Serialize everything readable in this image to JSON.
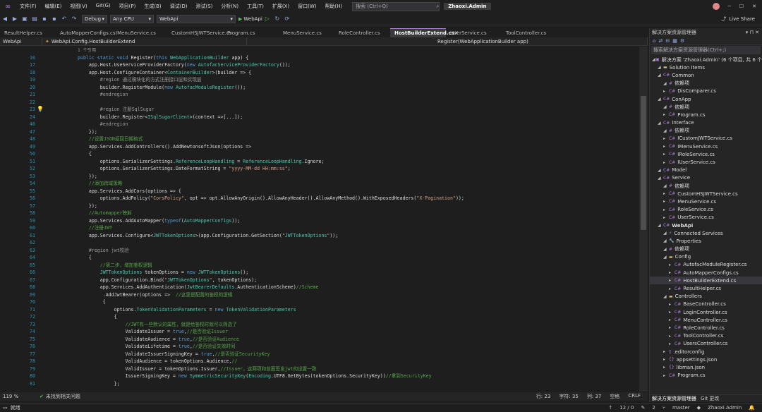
{
  "menu": {
    "items": [
      "文件(F)",
      "编辑(E)",
      "视图(V)",
      "Git(G)",
      "项目(P)",
      "生成(B)",
      "调试(D)",
      "测试(S)",
      "分析(N)",
      "工具(T)",
      "扩展(X)",
      "窗口(W)",
      "帮助(H)"
    ],
    "search_placeholder": "搜索 (Ctrl+Q)",
    "solution_name": "Zhaoxi.Admin"
  },
  "toolbar": {
    "config": "Debug",
    "platform": "Any CPU",
    "startup": "WebApi",
    "run_label": "WebApi",
    "live_share": "Live Share"
  },
  "tabs": [
    {
      "label": "ResultHelper.cs",
      "active": false
    },
    {
      "label": "AutoMapperConfigs.cs",
      "active": false
    },
    {
      "label": "IMenuService.cs",
      "active": false
    },
    {
      "label": "CustomHSJWTService.cs",
      "active": false
    },
    {
      "label": "Program.cs",
      "active": false
    },
    {
      "label": "MenuService.cs",
      "active": false
    },
    {
      "label": "RoleController.cs",
      "active": false
    },
    {
      "label": "HostBuilderExtend.cs",
      "active": true
    },
    {
      "label": "UserService.cs",
      "active": false
    },
    {
      "label": "ToolController.cs",
      "active": false
    }
  ],
  "nav": {
    "project": "WebApi",
    "class": "WebApi.Config.HostBuilderExtend",
    "member": "Register(WebApplicationBuilder app)"
  },
  "code": {
    "ref_hint": "1 个引用",
    "lines": [
      {
        "n": "16",
        "t": "public static void Register(this WebApplicationBuilder app) {"
      },
      {
        "n": "17",
        "t": "    app.Host.UseServiceProviderFactory(new AutofacServiceProviderFactory());"
      },
      {
        "n": "18",
        "t": "    app.Host.ConfigureContainer<ContainerBuilder>(builder => {"
      },
      {
        "n": "19",
        "t": "        #region 通过模块化的方式注册接口层和实现层"
      },
      {
        "n": "20",
        "t": "        builder.RegisterModule(new AutofacModuleRegister());"
      },
      {
        "n": "21",
        "t": "        #endregion"
      },
      {
        "n": "22",
        "t": ""
      },
      {
        "n": "23",
        "t": "        #region 注册SqlSugar"
      },
      {
        "n": "24",
        "t": "        builder.Register<ISqlSugarClient>(context =>[...]);"
      },
      {
        "n": "46",
        "t": "        #endregion"
      },
      {
        "n": "47",
        "t": "    });"
      },
      {
        "n": "48",
        "t": "    //设置JSON返回日期格式"
      },
      {
        "n": "49",
        "t": "    app.Services.AddControllers().AddNewtonsoftJson(options =>"
      },
      {
        "n": "50",
        "t": "    {"
      },
      {
        "n": "51",
        "t": "        options.SerializerSettings.ReferenceLoopHandling = ReferenceLoopHandling.Ignore;"
      },
      {
        "n": "52",
        "t": "        options.SerializerSettings.DateFormatString = \"yyyy-MM-dd HH:mm:ss\";"
      },
      {
        "n": "53",
        "t": "    });"
      },
      {
        "n": "54",
        "t": "    //添加跨域策略"
      },
      {
        "n": "55",
        "t": "    app.Services.AddCors(options => {"
      },
      {
        "n": "56",
        "t": "        options.AddPolicy(\"CorsPolicy\", opt => opt.AllowAnyOrigin().AllowAnyHeader().AllowAnyMethod().WithExposedHeaders(\"X-Pagination\"));"
      },
      {
        "n": "57",
        "t": "    });"
      },
      {
        "n": "58",
        "t": "    //Automapper映射"
      },
      {
        "n": "59",
        "t": "    app.Services.AddAutoMapper(typeof(AutoMapperConfigs));"
      },
      {
        "n": "60",
        "t": "    //注册JWT"
      },
      {
        "n": "61",
        "t": "    app.Services.Configure<JWTTokenOptions>(app.Configuration.GetSection(\"JWTTokenOptions\"));"
      },
      {
        "n": "62",
        "t": ""
      },
      {
        "n": "63",
        "t": "    #region jwt校验"
      },
      {
        "n": "64",
        "t": "    {"
      },
      {
        "n": "65",
        "t": "        //第二步，增加鉴权逻辑"
      },
      {
        "n": "66",
        "t": "        JWTTokenOptions tokenOptions = new JWTTokenOptions();"
      },
      {
        "n": "67",
        "t": "        app.Configuration.Bind(\"JWTTokenOptions\", tokenOptions);"
      },
      {
        "n": "68",
        "t": "        app.Services.AddAuthentication(JwtBearerDefaults.AuthenticationScheme)//Scheme"
      },
      {
        "n": "69",
        "t": "         .AddJwtBearer(options =>  //这里是配置的鉴权的逻辑"
      },
      {
        "n": "70",
        "t": "         {"
      },
      {
        "n": "71",
        "t": "             options.TokenValidationParameters = new TokenValidationParameters"
      },
      {
        "n": "72",
        "t": "             {"
      },
      {
        "n": "73",
        "t": "                 //JWT有一些默认的属性，就是给鉴权时就可以筛选了"
      },
      {
        "n": "74",
        "t": "                 ValidateIssuer = true,//是否验证Issuer"
      },
      {
        "n": "75",
        "t": "                 ValidateAudience = true,//是否验证Audience"
      },
      {
        "n": "76",
        "t": "                 ValidateLifetime = true,//是否验证失效时间"
      },
      {
        "n": "77",
        "t": "                 ValidateIssuerSigningKey = true,//是否验证SecurityKey"
      },
      {
        "n": "78",
        "t": "                 ValidAudience = tokenOptions.Audience,//"
      },
      {
        "n": "79",
        "t": "                 ValidIssuer = tokenOptions.Issuer,//Issuer，这两项和前面签发jwt的设置一致"
      },
      {
        "n": "80",
        "t": "                 IssuerSigningKey = new SymmetricSecurityKey(Encoding.UTF8.GetBytes(tokenOptions.SecurityKey))//拿到SecurityKey"
      },
      {
        "n": "81",
        "t": "             };"
      }
    ]
  },
  "editor_status": {
    "zoom": "119 %",
    "issues": "未找到相关问题",
    "line": "行: 23",
    "col": "字符: 35",
    "pos": "列: 37",
    "space": "空格",
    "crlf": "CRLF"
  },
  "statusbar": {
    "ready": "就绪",
    "lines": "12 / 0",
    "pencil": "2",
    "branch": "master",
    "repo": "Zhaoxi.Admin"
  },
  "solution_explorer": {
    "title": "解决方案资源管理器",
    "search_placeholder": "搜索解决方案资源管理器(Ctrl+;)",
    "rows": [
      {
        "label": "解决方案 'Zhaoxi.Admin' (6 个项目, 共 6 个",
        "indent": 0,
        "icon": "sln",
        "sel": false
      },
      {
        "label": "Solution Items",
        "indent": 1,
        "icon": "folder",
        "sel": false
      },
      {
        "label": "Common",
        "indent": 1,
        "icon": "proj",
        "sel": false
      },
      {
        "label": "依赖项",
        "indent": 2,
        "icon": "dep",
        "sel": false
      },
      {
        "label": "DisComparer.cs",
        "indent": 2,
        "icon": "cs",
        "sel": false
      },
      {
        "label": "ConApp",
        "indent": 1,
        "icon": "proj",
        "sel": false
      },
      {
        "label": "依赖项",
        "indent": 2,
        "icon": "dep",
        "sel": false
      },
      {
        "label": "Program.cs",
        "indent": 2,
        "icon": "cs",
        "sel": false
      },
      {
        "label": "Interface",
        "indent": 1,
        "icon": "proj",
        "sel": false
      },
      {
        "label": "依赖项",
        "indent": 2,
        "icon": "dep",
        "sel": false
      },
      {
        "label": "ICustomJWTService.cs",
        "indent": 2,
        "icon": "cs",
        "sel": false
      },
      {
        "label": "IMenuService.cs",
        "indent": 2,
        "icon": "cs",
        "sel": false
      },
      {
        "label": "IRoleService.cs",
        "indent": 2,
        "icon": "cs",
        "sel": false
      },
      {
        "label": "IUserService.cs",
        "indent": 2,
        "icon": "cs",
        "sel": false
      },
      {
        "label": "Model",
        "indent": 1,
        "icon": "proj",
        "sel": false
      },
      {
        "label": "Service",
        "indent": 1,
        "icon": "proj",
        "sel": false
      },
      {
        "label": "依赖项",
        "indent": 2,
        "icon": "dep",
        "sel": false
      },
      {
        "label": "CustomHSJWTService.cs",
        "indent": 2,
        "icon": "cs",
        "sel": false
      },
      {
        "label": "MenuService.cs",
        "indent": 2,
        "icon": "cs",
        "sel": false
      },
      {
        "label": "RoleService.cs",
        "indent": 2,
        "icon": "cs",
        "sel": false
      },
      {
        "label": "UserService.cs",
        "indent": 2,
        "icon": "cs",
        "sel": false
      },
      {
        "label": "WebApi",
        "indent": 1,
        "icon": "proj",
        "sel": false
      },
      {
        "label": "Connected Services",
        "indent": 2,
        "icon": "svc",
        "sel": false
      },
      {
        "label": "Properties",
        "indent": 2,
        "icon": "props",
        "sel": false
      },
      {
        "label": "依赖项",
        "indent": 2,
        "icon": "dep",
        "sel": false
      },
      {
        "label": "Config",
        "indent": 2,
        "icon": "folder",
        "sel": false
      },
      {
        "label": "AutofacModuleRegister.cs",
        "indent": 3,
        "icon": "cs",
        "sel": false
      },
      {
        "label": "AutoMapperConfigs.cs",
        "indent": 3,
        "icon": "cs",
        "sel": false
      },
      {
        "label": "HostBuilderExtend.cs",
        "indent": 3,
        "icon": "cs",
        "sel": true
      },
      {
        "label": "ResultHelper.cs",
        "indent": 3,
        "icon": "cs",
        "sel": false
      },
      {
        "label": "Controllers",
        "indent": 2,
        "icon": "folder",
        "sel": false
      },
      {
        "label": "BaseController.cs",
        "indent": 3,
        "icon": "cs",
        "sel": false
      },
      {
        "label": "LoginController.cs",
        "indent": 3,
        "icon": "cs",
        "sel": false
      },
      {
        "label": "MenuController.cs",
        "indent": 3,
        "icon": "cs",
        "sel": false
      },
      {
        "label": "RoleController.cs",
        "indent": 3,
        "icon": "cs",
        "sel": false
      },
      {
        "label": "ToolController.cs",
        "indent": 3,
        "icon": "cs",
        "sel": false
      },
      {
        "label": "UsersController.cs",
        "indent": 3,
        "icon": "cs",
        "sel": false
      },
      {
        "label": ".editorconfig",
        "indent": 2,
        "icon": "file",
        "sel": false
      },
      {
        "label": "appsettings.json",
        "indent": 2,
        "icon": "json",
        "sel": false
      },
      {
        "label": "libman.json",
        "indent": 2,
        "icon": "json",
        "sel": false
      },
      {
        "label": "Program.cs",
        "indent": 2,
        "icon": "cs",
        "sel": false
      }
    ],
    "bottom_tabs": [
      "解决方案资源管理器",
      "Git 更改"
    ]
  }
}
